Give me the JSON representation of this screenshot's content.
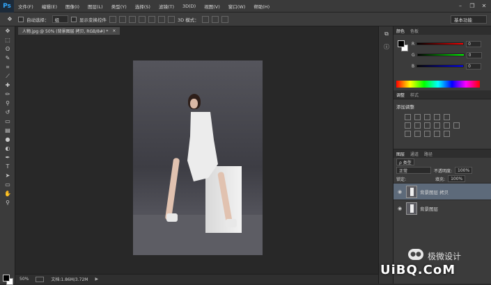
{
  "app": {
    "logo": "Ps"
  },
  "menu": [
    "文件(F)",
    "编辑(E)",
    "图像(I)",
    "图层(L)",
    "类型(Y)",
    "选择(S)",
    "滤镜(T)",
    "3D(D)",
    "视图(V)",
    "窗口(W)",
    "帮助(H)"
  ],
  "window_controls": [
    "–",
    "❐",
    "✕"
  ],
  "options": {
    "auto_select": "自动选择：",
    "auto_select_value": "组",
    "show_transform": "显示变换控件",
    "mode3d": "3D 模式：",
    "preset": "基本功能"
  },
  "document": {
    "tab": "人物.jpg @ 50% (背景图层 拷贝, RGB/8#) *",
    "close": "×"
  },
  "status": {
    "zoom": "50%",
    "doc": "文档:1.86M/3.72M"
  },
  "panels": {
    "color_tabs": [
      "颜色",
      "色板"
    ],
    "color": {
      "r_label": "R",
      "g_label": "G",
      "b_label": "B",
      "r": "0",
      "g": "0",
      "b": "0"
    },
    "adjust_tabs": [
      "调整",
      "样式"
    ],
    "adjust_title": "添加调整",
    "layers_tabs": [
      "图层",
      "通道",
      "路径"
    ],
    "kind": "ρ 类型",
    "blend": "正常",
    "opacity_label": "不透明度:",
    "opacity": "100%",
    "lock_label": "锁定:",
    "fill_label": "填充:",
    "fill": "100%",
    "layers": [
      {
        "name": "背景图层 拷贝",
        "selected": true
      },
      {
        "name": "背景图层",
        "selected": false
      }
    ]
  },
  "watermark": {
    "brand": "极微设计",
    "site": "UiBQ.CoM"
  },
  "colors": {
    "accent": "#31a8ff",
    "selected_layer": "#5d6a7a",
    "panel": "#3b3b3b",
    "canvas_bg": "#282828"
  }
}
